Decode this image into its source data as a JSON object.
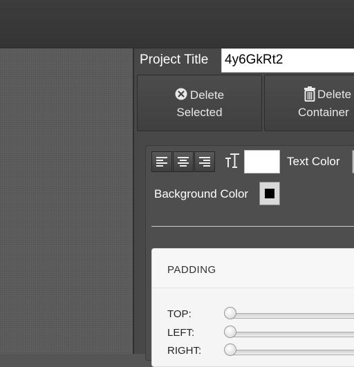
{
  "header": {},
  "editor": {
    "project_title_label": "Project Title",
    "project_title_value": "4y6GkRt2",
    "actions": {
      "delete_selected": {
        "line1": "Delete",
        "line2": "Selected",
        "icon": "x-circle-icon"
      },
      "delete_container": {
        "line1": "Delete",
        "line2": "Container",
        "icon": "trash-icon"
      }
    },
    "text_tools": {
      "align_buttons": [
        "align-left-icon",
        "align-center-icon",
        "align-right-icon"
      ],
      "font_size_icon": "text-size-icon",
      "font_size_value": "",
      "text_color_label": "Text Color",
      "text_color_value": "#bfbfbf",
      "background_color_label": "Background Color",
      "background_color_value": "#000000"
    },
    "padding": {
      "title": "PADDING",
      "rows": [
        {
          "label": "TOP:",
          "value": 0
        },
        {
          "label": "LEFT:",
          "value": 0
        },
        {
          "label": "RIGHT:",
          "value": 0
        }
      ]
    }
  },
  "colors": {
    "topbar": "#3a3a3a",
    "panel": "#484848",
    "canvas": "#5b5b5b"
  }
}
